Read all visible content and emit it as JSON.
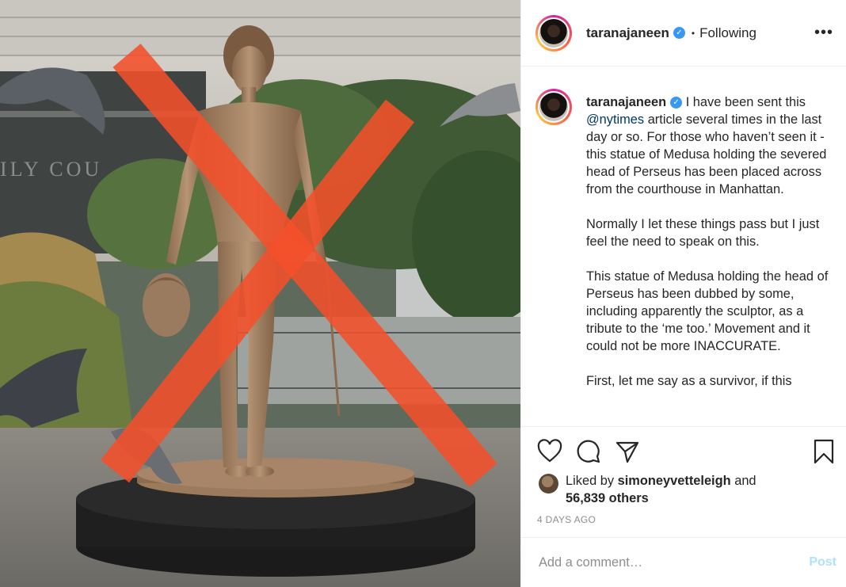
{
  "header": {
    "username": "taranajaneen",
    "separator": "•",
    "follow_status": "Following",
    "more_label": "•••"
  },
  "caption": {
    "username": "taranajaneen",
    "intro": "I have been sent this",
    "mention": "@nytimes",
    "line1_rest": "article several times in the last day or so. For those who haven’t seen it - this statue of Medusa holding the severed head of Perseus has been placed across from the courthouse in Manhattan.",
    "para2": "Normally I let these things pass but I just feel the need to speak on this.",
    "para3": "This statue of Medusa holding the head of Perseus has been dubbed by some, including apparently the sculptor, as a tribute to the ‘me too.’ Movement and it could not be more INACCURATE.",
    "para4": "First, let me say as a survivor, if this"
  },
  "likes": {
    "prefix": "Liked by",
    "liker": "simoneyvetteleigh",
    "and": "and",
    "others": "56,839 others"
  },
  "age": "4 DAYS AGO",
  "comment": {
    "placeholder": "Add a comment…",
    "post_label": "Post"
  },
  "image": {
    "building_sign": "ILY COU"
  },
  "colors": {
    "verified": "#3897f0",
    "mention": "#00376b",
    "post_disabled": "#b2dffc",
    "cross": "#f4502a"
  }
}
